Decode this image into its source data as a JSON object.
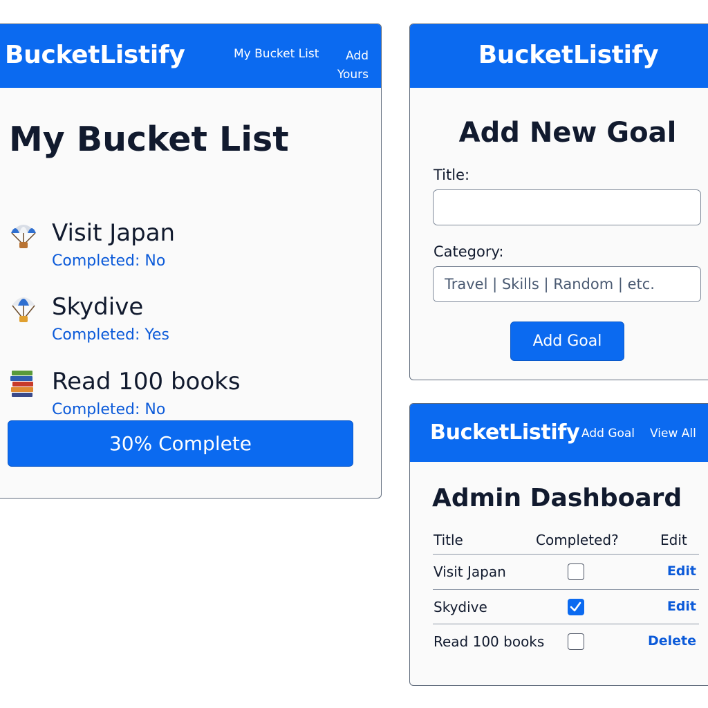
{
  "brand": "BucketListify",
  "list_card": {
    "nav": {
      "my_bucket_list": "My Bucket List",
      "add_yours": "Add Yours"
    },
    "title": "My Bucket List",
    "goals": [
      {
        "icon": "parachute-icon",
        "title": "Visit Japan",
        "status": "Completed: No"
      },
      {
        "icon": "parachute-icon",
        "title": "Skydive",
        "status": "Completed: Yes"
      },
      {
        "icon": "books-icon",
        "title": "Read 100 books",
        "status": "Completed: No"
      }
    ],
    "progress_label": "30% Complete"
  },
  "add_card": {
    "title": "Add New Goal",
    "title_label": "Title:",
    "title_value": "",
    "category_label": "Category:",
    "category_placeholder": "Travel | Skills | Random | etc.",
    "submit_label": "Add Goal"
  },
  "admin_card": {
    "nav": {
      "add_goal": "Add Goal",
      "view_all": "View All"
    },
    "title": "Admin Dashboard",
    "columns": [
      "Title",
      "Completed?",
      "Edit"
    ],
    "rows": [
      {
        "title": "Visit Japan",
        "completed": false,
        "action": "Edit"
      },
      {
        "title": "Skydive",
        "completed": true,
        "action": "Edit"
      },
      {
        "title": "Read 100 books",
        "completed": false,
        "action": "Delete"
      }
    ]
  },
  "colors": {
    "primary": "#0b6af0",
    "link": "#0b5ad9",
    "text": "#111a2e"
  }
}
